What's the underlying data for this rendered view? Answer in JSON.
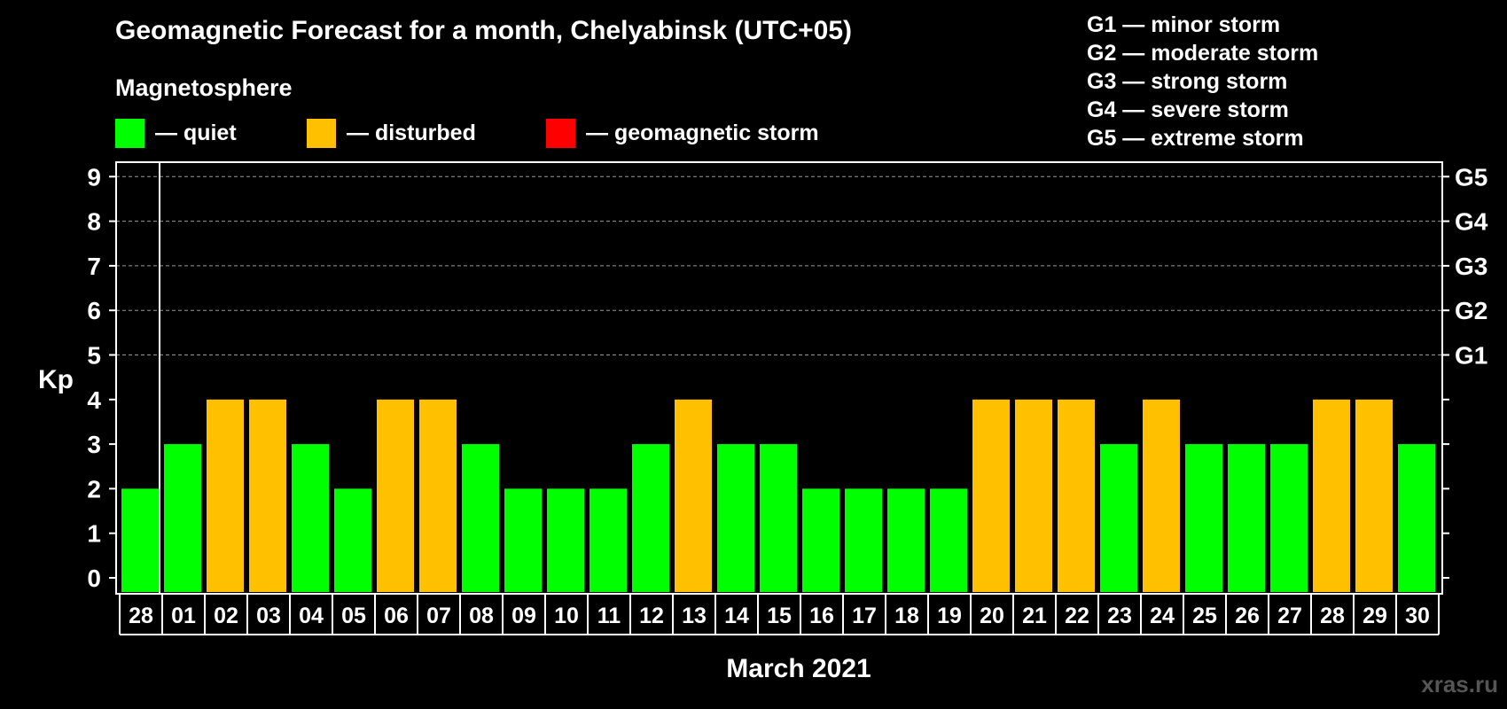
{
  "chart_data": {
    "type": "bar",
    "title": "Geomagnetic Forecast for a month, Chelyabinsk (UTC+05)",
    "subtitle": "Magnetosphere",
    "ylabel": "Kp",
    "xlabel": "March 2021",
    "ylim": [
      0,
      9
    ],
    "y_ticks": [
      "0",
      "1",
      "2",
      "3",
      "4",
      "5",
      "6",
      "7",
      "8",
      "9"
    ],
    "right_ticks": [
      {
        "kp": 5,
        "label": "G1"
      },
      {
        "kp": 6,
        "label": "G2"
      },
      {
        "kp": 7,
        "label": "G3"
      },
      {
        "kp": 8,
        "label": "G4"
      },
      {
        "kp": 9,
        "label": "G5"
      }
    ],
    "grid": "dashed horizontal at Kp 5–9",
    "categories": [
      "28",
      "01",
      "02",
      "03",
      "04",
      "05",
      "06",
      "07",
      "08",
      "09",
      "10",
      "11",
      "12",
      "13",
      "14",
      "15",
      "16",
      "17",
      "18",
      "19",
      "20",
      "21",
      "22",
      "23",
      "24",
      "25",
      "26",
      "27",
      "28",
      "29",
      "30"
    ],
    "values": [
      2,
      3,
      4,
      4,
      3,
      2,
      4,
      4,
      3,
      2,
      2,
      2,
      3,
      4,
      3,
      3,
      2,
      2,
      2,
      2,
      4,
      4,
      4,
      3,
      4,
      3,
      3,
      3,
      4,
      4,
      3
    ],
    "legend": [
      {
        "label": "— quiet",
        "color": "#00ff00"
      },
      {
        "label": "— disturbed",
        "color": "#ffc000"
      },
      {
        "label": "— geomagnetic storm",
        "color": "#ff0000"
      }
    ],
    "storm_scale": [
      "G1 — minor storm",
      "G2 — moderate storm",
      "G3 — strong storm",
      "G4 — severe storm",
      "G5 — extreme storm"
    ],
    "colors": {
      "quiet": "#00ff00",
      "disturbed": "#ffc000",
      "storm": "#ff0000",
      "background": "#000000",
      "axis": "#ffffff",
      "grid": "#9a9a9a"
    }
  },
  "watermark": "xras.ru"
}
